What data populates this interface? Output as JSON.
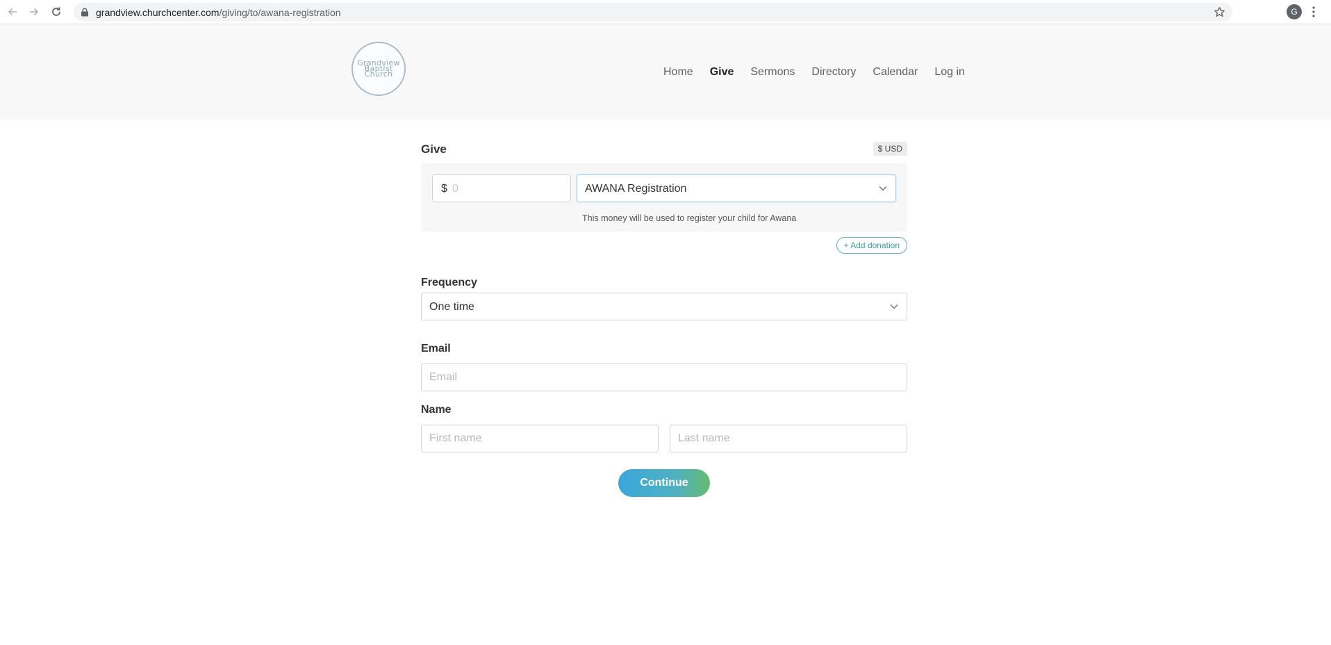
{
  "browser": {
    "url_host": "grandview.churchcenter.com",
    "url_path": "/giving/to/awana-registration",
    "profile_initial": "G",
    "icons": [
      "back-arrow-icon",
      "forward-arrow-icon",
      "reload-icon",
      "lock-icon",
      "star-icon",
      "kebab-menu-icon"
    ]
  },
  "site": {
    "logo_text": "Grandview\nBaptist\nChurch",
    "nav": [
      {
        "label": "Home",
        "active": false
      },
      {
        "label": "Give",
        "active": true
      },
      {
        "label": "Sermons",
        "active": false
      },
      {
        "label": "Directory",
        "active": false
      },
      {
        "label": "Calendar",
        "active": false
      },
      {
        "label": "Log in",
        "active": false
      }
    ]
  },
  "give": {
    "title": "Give",
    "currency": "$ USD",
    "amount_symbol": "$",
    "amount_placeholder": "0",
    "fund_selected": "AWANA Registration",
    "fund_description": "This money will be used to register your child for Awana",
    "add_donation": "+ Add donation"
  },
  "frequency": {
    "label": "Frequency",
    "selected": "One time"
  },
  "email": {
    "label": "Email",
    "placeholder": "Email"
  },
  "name": {
    "label": "Name",
    "first_placeholder": "First name",
    "last_placeholder": "Last name"
  },
  "actions": {
    "continue_label": "Continue"
  },
  "colors": {
    "accent_teal": "#3f9f97",
    "button_gradient_start": "#3aa6da",
    "button_gradient_end": "#64bb72"
  }
}
